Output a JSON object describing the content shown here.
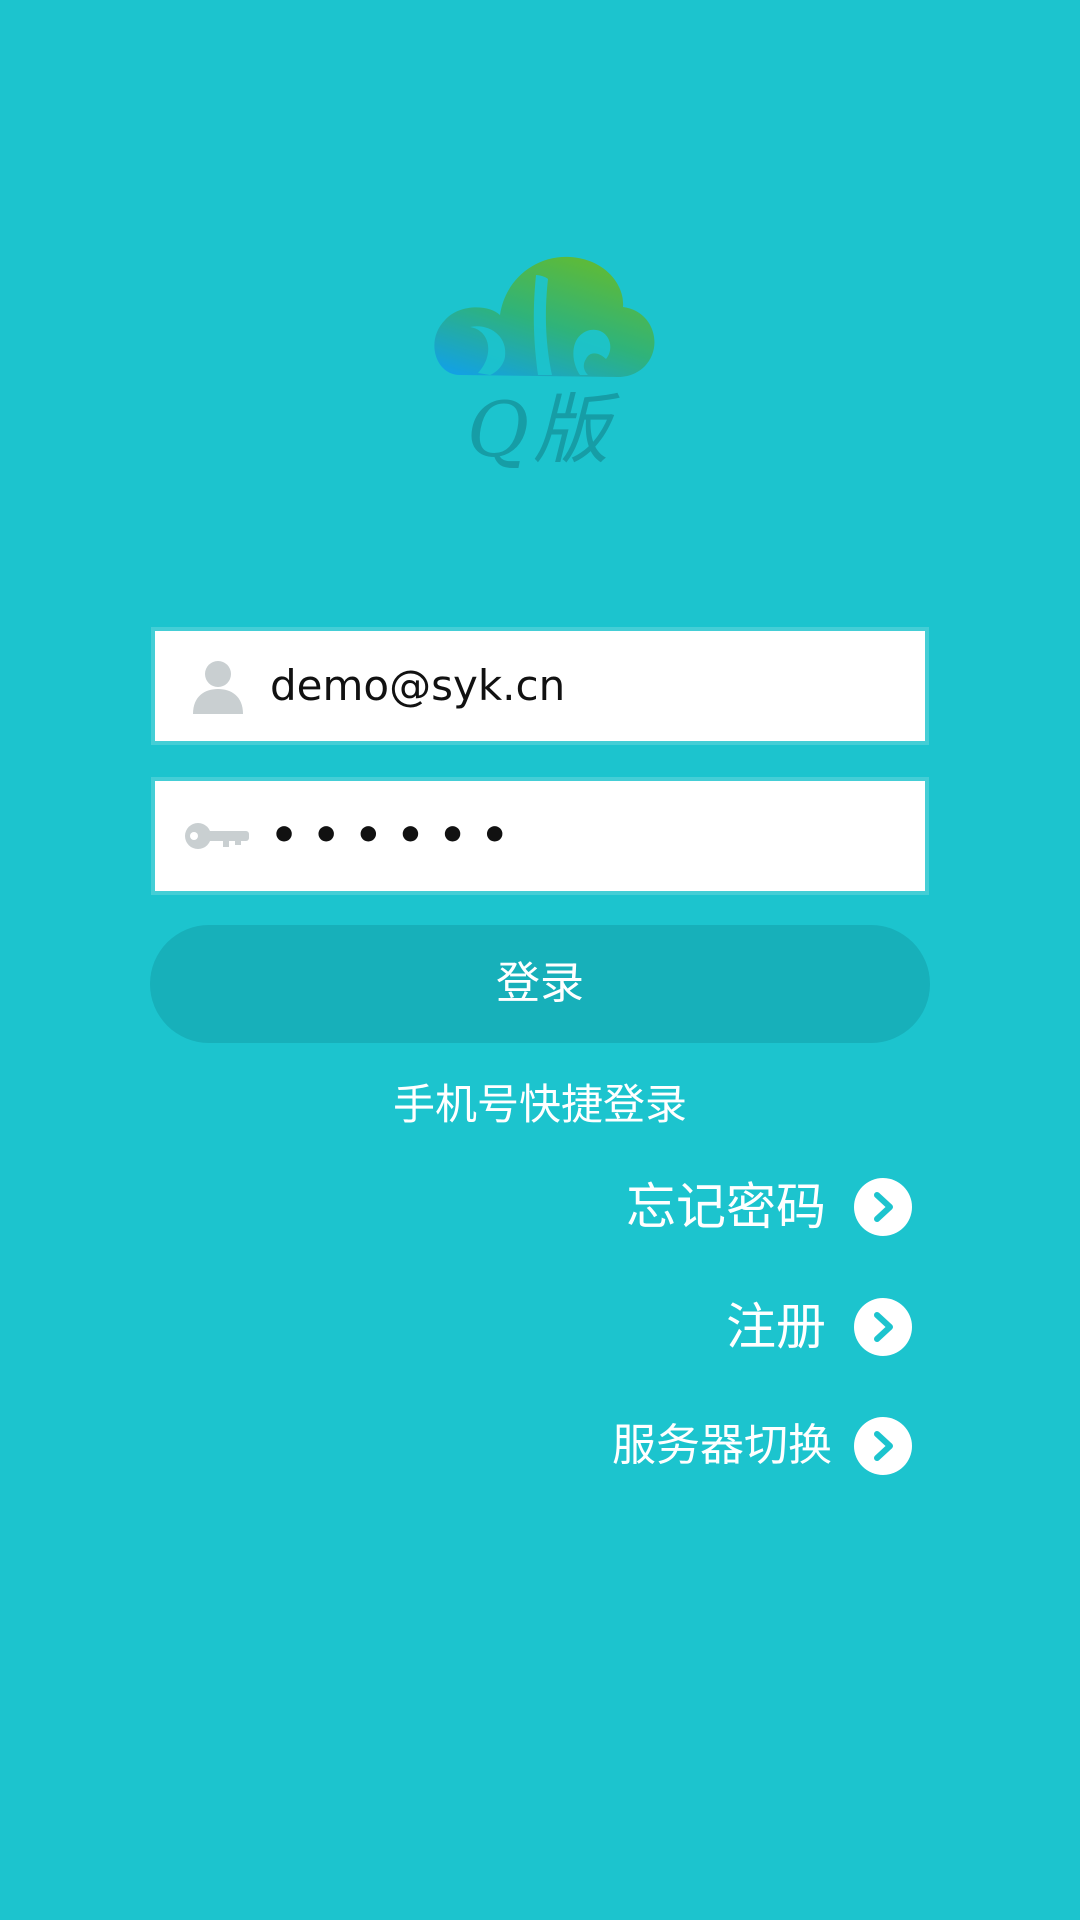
{
  "colors": {
    "background": "#1cc4ce",
    "button": "#17b0ba",
    "text": "#ffffff",
    "icon_gray": "#c9cfd1",
    "logo_green": "#4cb848",
    "logo_blue": "#12a0e6"
  },
  "logo": {
    "icon": "cloud-logo-icon",
    "caption": "Q版"
  },
  "login_form": {
    "username": {
      "icon": "user-icon",
      "value": "demo@syk.cn"
    },
    "password": {
      "icon": "key-icon",
      "value": "••••••"
    },
    "login_label": "登录"
  },
  "links": {
    "quick_login": "手机号快捷登录",
    "forgot_password": "忘记密码",
    "register": "注册",
    "server_switch": "服务器切换",
    "arrow_icon": "chevron-right-icon"
  }
}
